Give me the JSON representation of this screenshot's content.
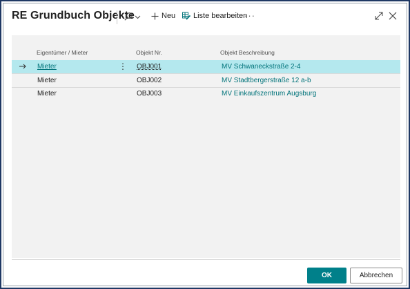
{
  "dialog": {
    "title": "RE Grundbuch Objekte"
  },
  "toolbar": {
    "new_label": "Neu",
    "edit_list_label": "Liste bearbeiten",
    "more_label": "···"
  },
  "table": {
    "columns": [
      "Eigentümer / Mieter",
      "Objekt Nr.",
      "Objekt Beschreibung"
    ],
    "rows": [
      {
        "owner": "Mieter",
        "number": "OBJ001",
        "description": "MV Schwaneckstraße 2-4",
        "selected": true
      },
      {
        "owner": "Mieter",
        "number": "OBJ002",
        "description": "MV Stadtbergerstraße 12 a-b",
        "selected": false
      },
      {
        "owner": "Mieter",
        "number": "OBJ003",
        "description": "MV Einkaufszentrum Augsburg",
        "selected": false
      }
    ]
  },
  "footer": {
    "ok_label": "OK",
    "cancel_label": "Abbrechen"
  },
  "colors": {
    "accent": "#00808a",
    "link": "#00737a",
    "selected_row": "#b4e8ee",
    "frame_border": "#1f3864"
  },
  "icons": {
    "search": "search-icon",
    "dropdown": "chevron-down-icon",
    "new": "plus-icon",
    "edit_list": "edit-list-icon",
    "expand": "expand-icon",
    "close": "close-icon",
    "row_pointer": "arrow-right-icon",
    "row_menu": "kebab-icon"
  }
}
